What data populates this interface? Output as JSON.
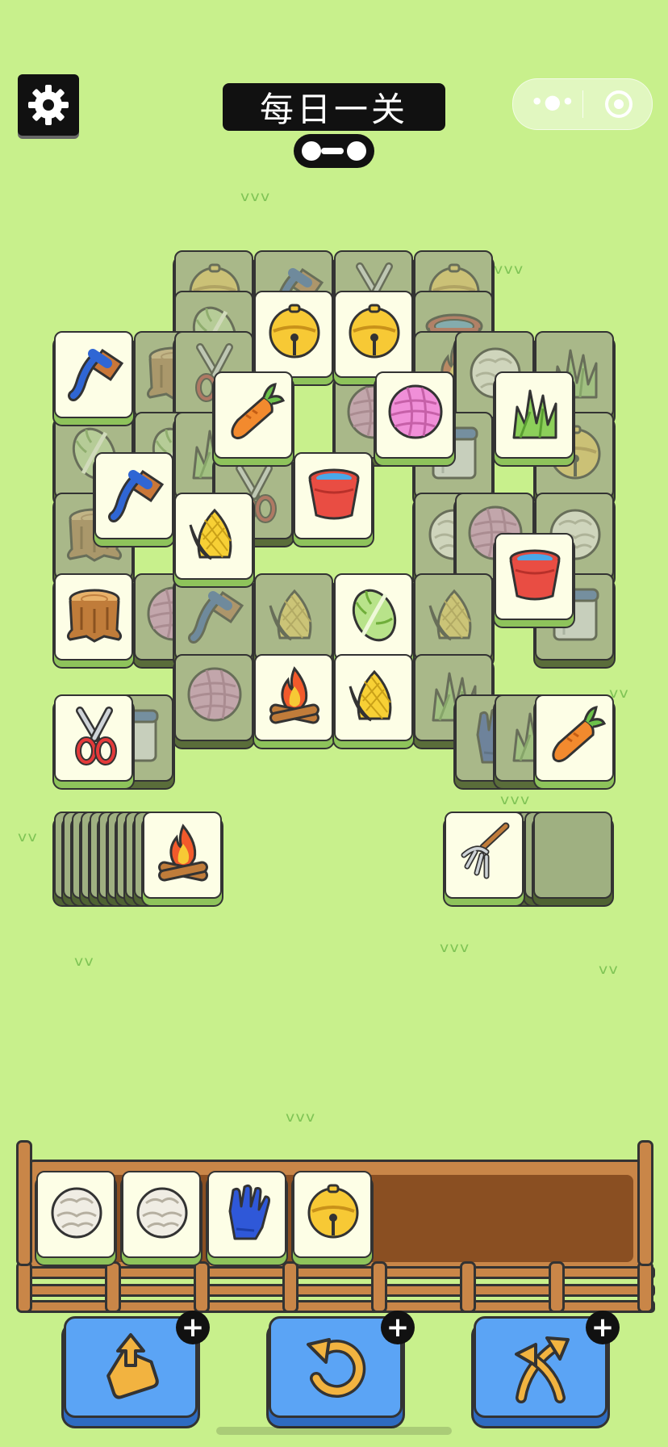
{
  "header": {
    "title": "每日一关",
    "settings_icon": "gear-icon",
    "menu_more_icon": "more-dots-icon",
    "menu_close_icon": "target-close-icon"
  },
  "progress": {
    "value": 0.5
  },
  "colors": {
    "background": "#c8f08c",
    "tile_active": "#fdfee6",
    "tile_blocked": "#b3c48f",
    "powerup": "#5ba4f5",
    "wood": "#c98648"
  },
  "tiles": [
    {
      "icon": "bell",
      "state": "blocked"
    },
    {
      "icon": "brush",
      "state": "blocked"
    },
    {
      "icon": "shears",
      "state": "blocked"
    },
    {
      "icon": "bell",
      "state": "blocked"
    },
    {
      "icon": "cabbage",
      "state": "blocked"
    },
    {
      "icon": "bell",
      "state": "active"
    },
    {
      "icon": "bell",
      "state": "active"
    },
    {
      "icon": "bowl",
      "state": "blocked"
    },
    {
      "icon": "stump",
      "state": "blocked"
    },
    {
      "icon": "shears",
      "state": "blocked"
    },
    {
      "icon": "campfire",
      "state": "blocked"
    },
    {
      "icon": "wool",
      "state": "blocked"
    },
    {
      "icon": "grass",
      "state": "blocked"
    },
    {
      "icon": "brush",
      "state": "active"
    },
    {
      "icon": "carrot",
      "state": "active"
    },
    {
      "icon": "yarn",
      "state": "blocked"
    },
    {
      "icon": "yarn",
      "state": "active"
    },
    {
      "icon": "grass",
      "state": "active"
    },
    {
      "icon": "cabbage",
      "state": "blocked"
    },
    {
      "icon": "cabbage",
      "state": "blocked"
    },
    {
      "icon": "grass",
      "state": "blocked"
    },
    {
      "icon": "shears",
      "state": "blocked"
    },
    {
      "icon": "bucket",
      "state": "active"
    },
    {
      "icon": "can",
      "state": "blocked"
    },
    {
      "icon": "bell",
      "state": "blocked"
    },
    {
      "icon": "brush",
      "state": "active"
    },
    {
      "icon": "stump",
      "state": "blocked"
    },
    {
      "icon": "corn",
      "state": "active"
    },
    {
      "icon": "wool",
      "state": "blocked"
    },
    {
      "icon": "wool",
      "state": "blocked"
    },
    {
      "icon": "yarn",
      "state": "blocked"
    },
    {
      "icon": "bucket",
      "state": "active"
    },
    {
      "icon": "stump",
      "state": "active"
    },
    {
      "icon": "yarn",
      "state": "blocked"
    },
    {
      "icon": "brush",
      "state": "blocked"
    },
    {
      "icon": "corn",
      "state": "blocked"
    },
    {
      "icon": "cabbage",
      "state": "active"
    },
    {
      "icon": "corn",
      "state": "blocked"
    },
    {
      "icon": "can",
      "state": "blocked"
    },
    {
      "icon": "yarn",
      "state": "blocked"
    },
    {
      "icon": "campfire",
      "state": "active"
    },
    {
      "icon": "corn",
      "state": "active"
    },
    {
      "icon": "grass",
      "state": "blocked"
    },
    {
      "icon": "can",
      "state": "blocked"
    },
    {
      "icon": "shears",
      "state": "active"
    },
    {
      "icon": "glove",
      "state": "blocked"
    },
    {
      "icon": "grass",
      "state": "blocked"
    },
    {
      "icon": "carrot",
      "state": "active"
    }
  ],
  "stacks": {
    "left": {
      "count": 11,
      "top_icon": "campfire"
    },
    "right": {
      "count": 11,
      "top_icon": "pitchfork"
    }
  },
  "tray": {
    "capacity": 7,
    "items": [
      "wool",
      "wool",
      "glove",
      "bell"
    ]
  },
  "powerups": [
    {
      "icon": "remove-out-icon",
      "plus": "+"
    },
    {
      "icon": "undo-icon",
      "plus": "+"
    },
    {
      "icon": "shuffle-icon",
      "plus": "+"
    }
  ]
}
